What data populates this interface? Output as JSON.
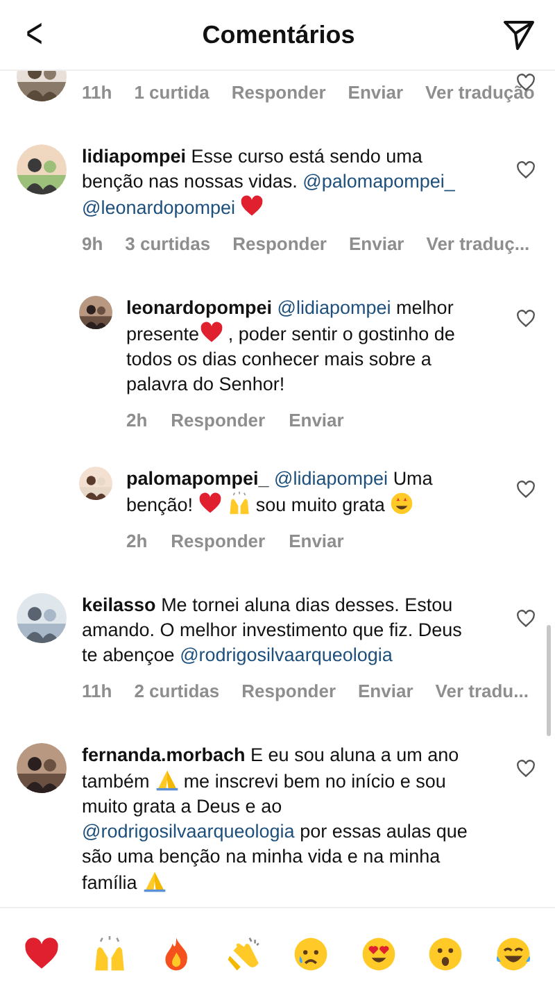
{
  "header": {
    "back": "<",
    "title": "Comentários"
  },
  "comments": [
    {
      "cut": true,
      "meta": [
        "11h",
        "1 curtida",
        "Responder",
        "Enviar",
        "Ver tradução"
      ]
    },
    {
      "user": "lidiapompei",
      "segments": [
        {
          "kind": "text",
          "text": "Esse curso está sendo uma benção nas nossas vidas."
        },
        {
          "kind": "mention",
          "text": "@palomapompei_"
        },
        {
          "kind": "mention",
          "text": "@leonardopompei"
        },
        {
          "kind": "heart"
        }
      ],
      "meta": [
        "9h",
        "3 curtidas",
        "Responder",
        "Enviar",
        "Ver traduç..."
      ],
      "replies": [
        {
          "user": "leonardopompei",
          "segments": [
            {
              "kind": "mention",
              "text": "@lidiapompei"
            },
            {
              "kind": "text",
              "text": "melhor presente"
            },
            {
              "kind": "heart",
              "attached": true
            },
            {
              "kind": "text",
              "text": ", poder sentir o gostinho de todos os dias conhecer mais sobre a palavra do Senhor!"
            }
          ],
          "meta": [
            "2h",
            "Responder",
            "Enviar"
          ]
        },
        {
          "user": "palomapompei_",
          "segments": [
            {
              "kind": "mention",
              "text": "@lidiapompei"
            },
            {
              "kind": "text",
              "text": "Uma benção!"
            },
            {
              "kind": "heart"
            },
            {
              "kind": "hands"
            },
            {
              "kind": "text",
              "text": "sou muito grata"
            },
            {
              "kind": "starstruck"
            }
          ],
          "meta": [
            "2h",
            "Responder",
            "Enviar"
          ]
        }
      ]
    },
    {
      "user": "keilasso",
      "segments": [
        {
          "kind": "text",
          "text": "Me tornei aluna dias desses. Estou amando. O melhor investimento que fiz. Deus te abençoe"
        },
        {
          "kind": "mention",
          "text": "@rodrigosilvaarqueologia"
        }
      ],
      "meta": [
        "11h",
        "2 curtidas",
        "Responder",
        "Enviar",
        "Ver tradu..."
      ]
    },
    {
      "user": "fernanda.morbach",
      "segments": [
        {
          "kind": "text",
          "text": "E eu sou aluna a um ano também"
        },
        {
          "kind": "pray"
        },
        {
          "kind": "text",
          "text": "me inscrevi bem no início e sou muito grata a Deus e ao"
        },
        {
          "kind": "mention",
          "text": "@rodrigosilvaarqueologia"
        },
        {
          "kind": "text",
          "text": "por essas aulas que são uma benção na minha vida e na minha família"
        },
        {
          "kind": "pray"
        }
      ]
    }
  ],
  "reactions": [
    {
      "kind": "heart"
    },
    {
      "kind": "hands"
    },
    {
      "kind": "fire"
    },
    {
      "kind": "clap"
    },
    {
      "kind": "cry"
    },
    {
      "kind": "hearteyes"
    },
    {
      "kind": "surprised"
    },
    {
      "kind": "joy"
    }
  ]
}
